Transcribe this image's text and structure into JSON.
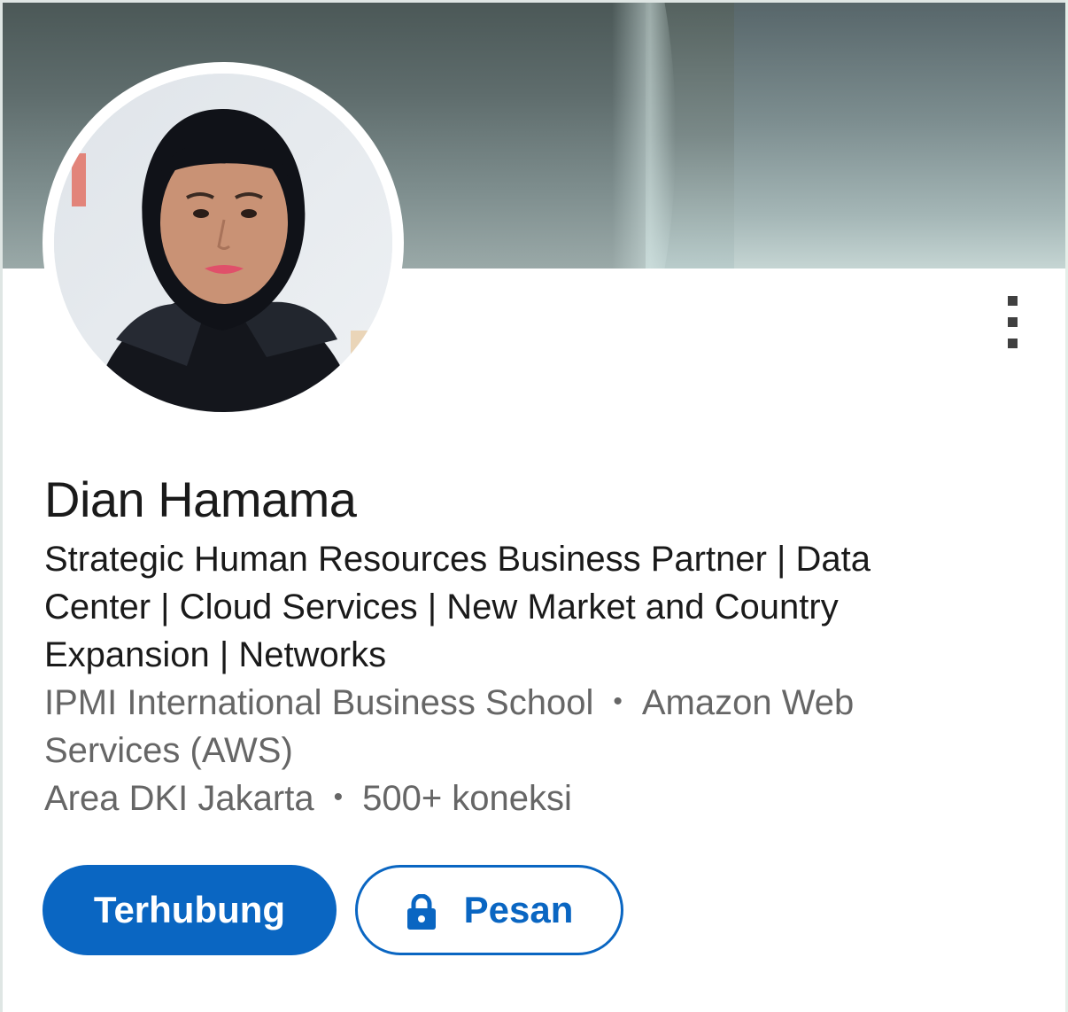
{
  "profile": {
    "name": "Dian Hamama",
    "headline_lines": [
      "Strategic Human Resources Business Partner | Data",
      "Center | Cloud Services | New Market and Country",
      "Expansion | Networks"
    ],
    "education": "IPMI International Business School",
    "company_line1": "Amazon Web",
    "company_line2": "Services (AWS)",
    "location": "Area DKI Jakarta",
    "connections": "500+ koneksi",
    "separator": "•"
  },
  "actions": {
    "connect_label": "Terhubung",
    "message_label": "Pesan"
  },
  "icons": {
    "more": "more-vertical-icon",
    "lock": "lock-icon"
  },
  "colors": {
    "accent": "#0a66c2",
    "text_primary": "#1a1a1a",
    "text_secondary": "#666666"
  }
}
